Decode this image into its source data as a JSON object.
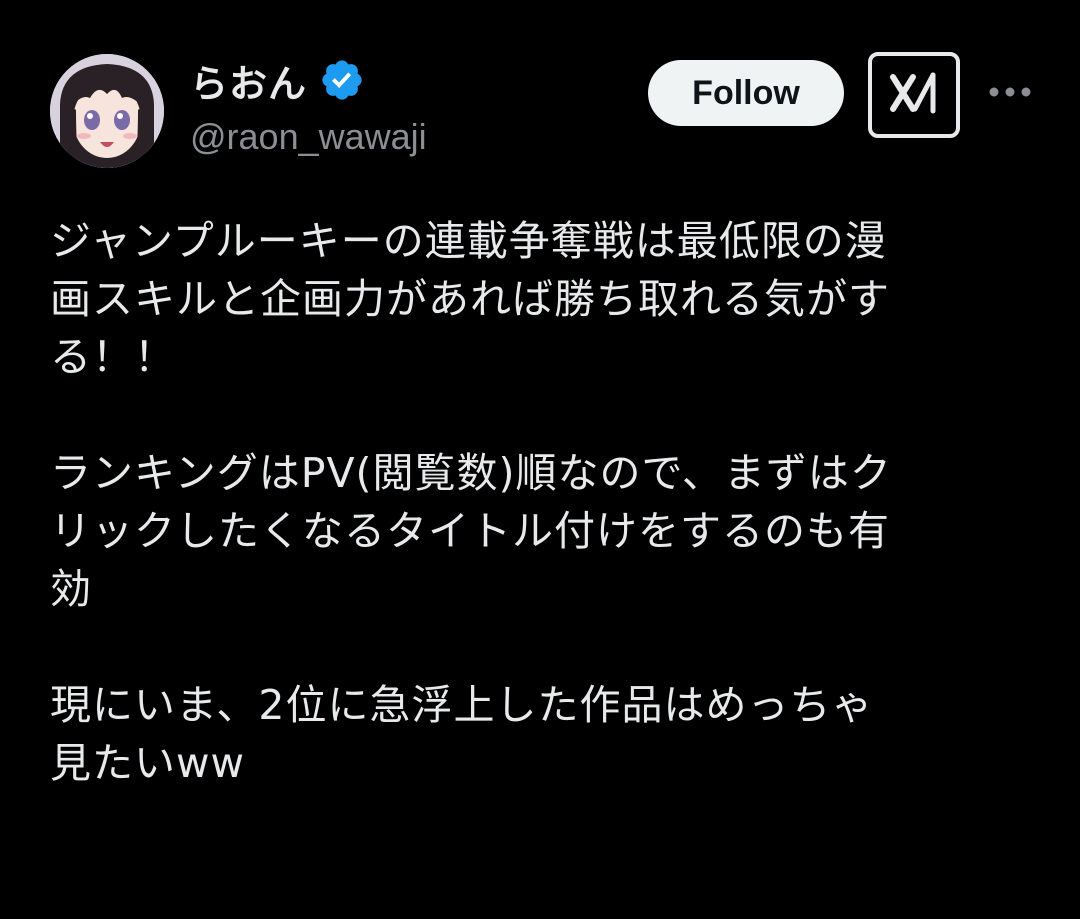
{
  "author": {
    "display_name": "らおん",
    "handle": "@raon_wawaji",
    "verified": true,
    "verified_color": "#1d9bf0"
  },
  "actions": {
    "follow_label": "Follow",
    "grok_icon": "grok-logo-icon",
    "more_icon": "more-horizontal-icon"
  },
  "tweet": {
    "paragraphs": [
      "ジャンプルーキーの連載争奪戦は最低限の漫\n画スキルと企画力があれば勝ち取れる気がす\nる！！",
      "ランキングはPV(閲覧数)順なので、まずはク\nリックしたくなるタイトル付けをするのも有\n効",
      "現にいま、2位に急浮上した作品はめっちゃ\n見たいww"
    ]
  },
  "colors": {
    "background": "#000000",
    "text_primary": "#e7e9ea",
    "text_secondary": "#8b8f94",
    "button_bg": "#eff3f4"
  }
}
